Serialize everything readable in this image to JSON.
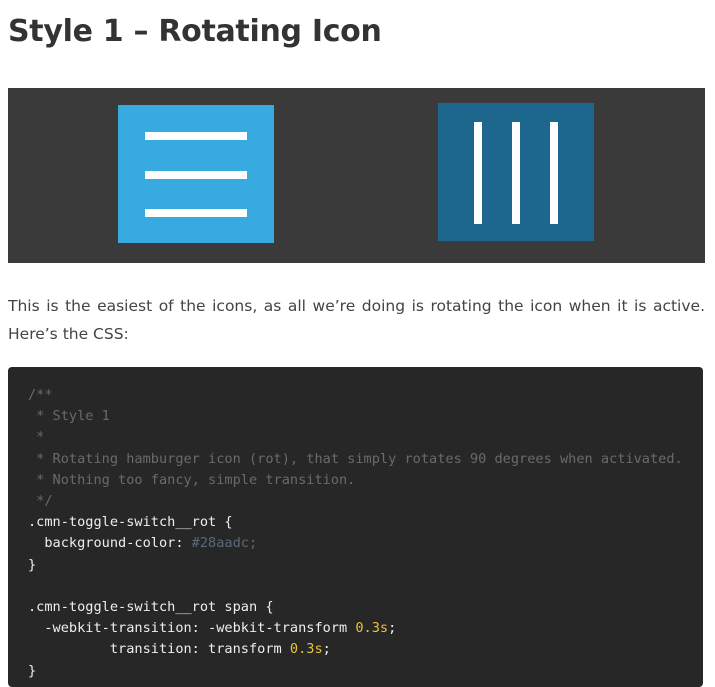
{
  "heading": "Style 1 – Rotating Icon",
  "demo": {
    "background": "#3a3a3a",
    "button_normal": {
      "color": "#37abe0",
      "state": "inactive",
      "icon": "hamburger-icon"
    },
    "button_rotated": {
      "color": "#1d678f",
      "state": "active",
      "icon": "hamburger-rotated-icon"
    }
  },
  "paragraph": "This is the easiest of the icons, as all we’re doing is rotating the icon when it is active. Here’s the CSS:",
  "code": {
    "background": "#272727",
    "lines": [
      "/**",
      " * Style 1",
      " *",
      " * Rotating hamburger icon (rot), that simply rotates 90 degrees when activated.",
      " * Nothing too fancy, simple transition.",
      " */",
      ".cmn-toggle-switch__rot {",
      "  background-color:",
      " #28aadc;",
      "}",
      "",
      ".cmn-toggle-switch__rot span {",
      "  -webkit-transition: -webkit-transform ",
      "0.3s",
      ";",
      "          transition: transform ",
      "0.3s",
      ";",
      "}"
    ]
  }
}
